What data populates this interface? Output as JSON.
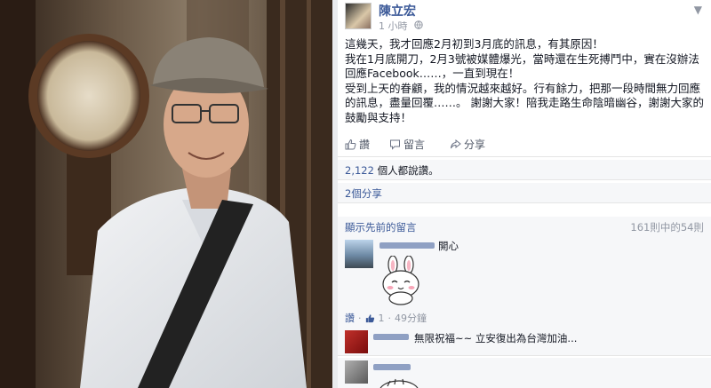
{
  "post": {
    "author": "陳立宏",
    "time": "1 小時",
    "body": [
      "這幾天，我才回應2月初到3月底的訊息，有其原因！",
      "我在1月底開刀，2月3號被媒體爆光，當時還在生死搏鬥中，實在沒辦法回應Facebook……，一直到現在！",
      "受到上天的眷顧，我的情況越來越好。行有餘力，把那一段時間無力回應的訊息，盡量回覆……。 謝謝大家！陪我走路生命陰暗幽谷，謝謝大家的鼓勵與支持！"
    ]
  },
  "actions": {
    "like": "讚",
    "comment": "留言",
    "share": "分享"
  },
  "likes": {
    "count": "2,122",
    "suffix": "個人都說讚。"
  },
  "shares": {
    "count": "2個分享"
  },
  "comments_header": {
    "show_previous": "顯示先前的留言",
    "counter": "161則中的54則"
  },
  "comments": [
    {
      "text": "開心",
      "like": "讚",
      "likes": "1",
      "time": "49分鐘"
    },
    {
      "text": "無限祝福~~ 立安復出為台灣加油..."
    }
  ],
  "colors": {
    "link": "#3b5998",
    "meta": "#9197a3",
    "panel": "#f6f7f9"
  }
}
